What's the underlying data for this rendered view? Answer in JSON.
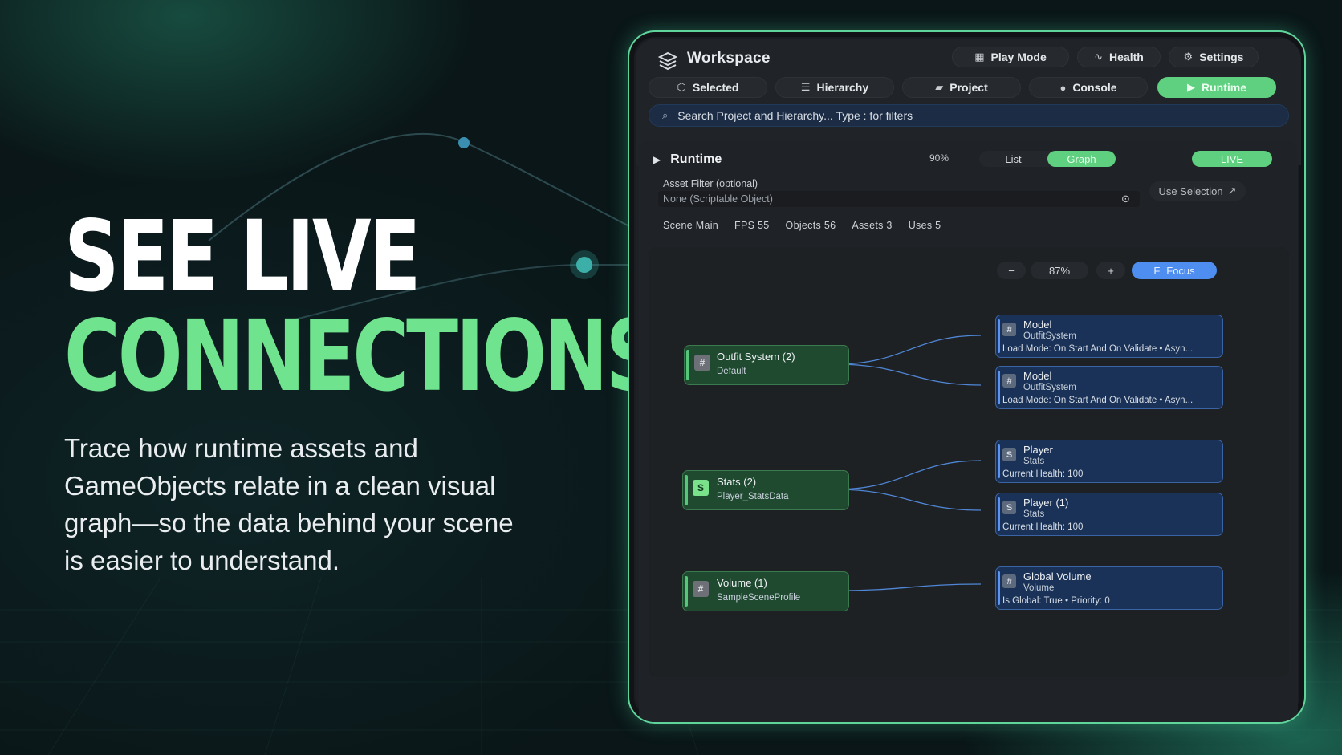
{
  "hero": {
    "headline_line1": "SEE LIVE",
    "headline_line2": "CONNECTIONS.",
    "subtitle": "Trace how runtime assets and GameObjects relate in a clean visual graph—so the data behind your scene is easier to understand."
  },
  "colors": {
    "accent_green": "#5ed07f",
    "accent_blue": "#4e8ef0",
    "panel_border": "#5fd49b"
  },
  "workspace": {
    "title": "Workspace",
    "logo_icon": "stacked-layers-icon",
    "header_buttons": [
      {
        "label": "Play Mode",
        "icon": "grid-icon"
      },
      {
        "label": "Health",
        "icon": "pulse-icon"
      },
      {
        "label": "Settings",
        "icon": "gear-icon"
      }
    ],
    "tabs": [
      {
        "label": "Selected",
        "icon": "cube-icon"
      },
      {
        "label": "Hierarchy",
        "icon": "list-icon"
      },
      {
        "label": "Project",
        "icon": "folder-icon"
      },
      {
        "label": "Console",
        "icon": "alert-icon"
      },
      {
        "label": "Runtime",
        "icon": "play-icon",
        "active": true
      }
    ],
    "search_placeholder": "Search Project and Hierarchy...  Type : for filters"
  },
  "runtime": {
    "title": "Runtime",
    "zoom_chip": "90%",
    "view_options": [
      "List",
      "Graph"
    ],
    "view_selected": "Graph",
    "live_label": "LIVE",
    "asset_filter_label": "Asset Filter (optional)",
    "asset_filter_value": "None (Scriptable Object)",
    "use_selection_label": "Use Selection",
    "stats": [
      {
        "label": "Scene",
        "value": "Main"
      },
      {
        "label": "FPS",
        "value": "55"
      },
      {
        "label": "Objects",
        "value": "56"
      },
      {
        "label": "Assets",
        "value": "3"
      },
      {
        "label": "Uses",
        "value": "5"
      }
    ]
  },
  "graph": {
    "zoom_out": "−",
    "zoom_level": "87%",
    "zoom_in": "+",
    "focus_key": "F",
    "focus_label": "Focus",
    "sources": [
      {
        "badge": "#",
        "title": "Outfit System (2)",
        "subtitle": "Default"
      },
      {
        "badge": "S",
        "title": "Stats (2)",
        "subtitle": "Player_StatsData"
      },
      {
        "badge": "#",
        "title": "Volume (1)",
        "subtitle": "SampleSceneProfile"
      }
    ],
    "targets": [
      {
        "badge": "#",
        "title": "Model",
        "subtitle": "OutfitSystem",
        "detail": "Load Mode: On Start And On Validate  •  Asyn..."
      },
      {
        "badge": "#",
        "title": "Model",
        "subtitle": "OutfitSystem",
        "detail": "Load Mode: On Start And On Validate  •  Asyn..."
      },
      {
        "badge": "S",
        "title": "Player",
        "subtitle": "Stats",
        "detail": "Current Health: 100"
      },
      {
        "badge": "S",
        "title": "Player (1)",
        "subtitle": "Stats",
        "detail": "Current Health: 100"
      },
      {
        "badge": "#",
        "title": "Global Volume",
        "subtitle": "Volume",
        "detail": "Is Global: True  •  Priority: 0"
      }
    ]
  }
}
